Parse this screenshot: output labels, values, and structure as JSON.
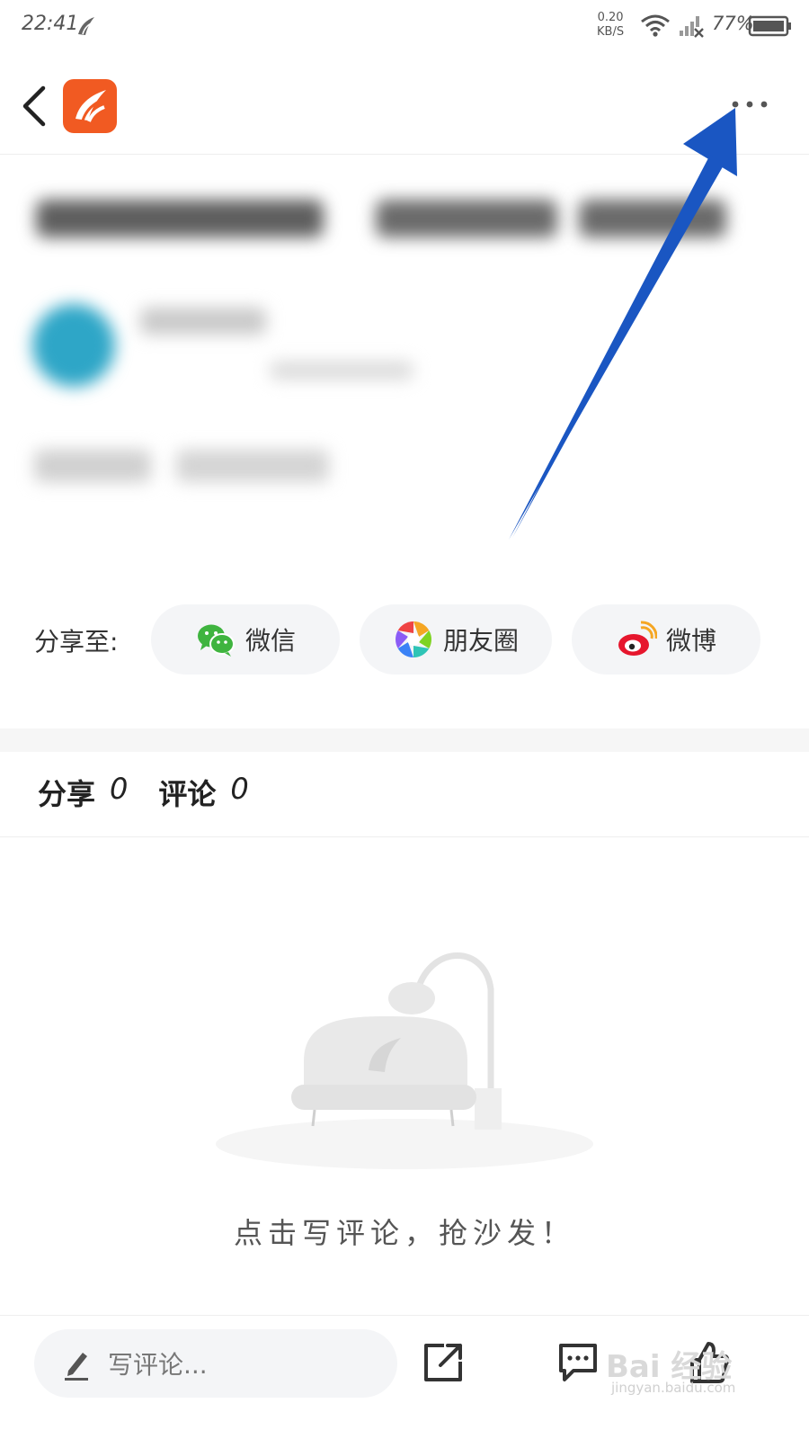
{
  "status_bar": {
    "time": "22:41",
    "speed_value": "0.20",
    "speed_unit": "KB/S",
    "battery": "77%"
  },
  "nav": {
    "back_icon": "chevron-left-icon",
    "logo_icon": "app-logo",
    "more_icon": "more-dots-icon"
  },
  "share": {
    "label": "分享至:",
    "targets": [
      {
        "label": "微信",
        "icon": "wechat-icon",
        "color": "#3fb43f"
      },
      {
        "label": "朋友圈",
        "icon": "moments-icon",
        "color": "#f5a623"
      },
      {
        "label": "微博",
        "icon": "weibo-icon",
        "color": "#e6162d"
      }
    ]
  },
  "counts": {
    "share_label": "分享",
    "share_count": "0",
    "comment_label": "评论",
    "comment_count": "0"
  },
  "empty_state": {
    "text": "点击写评论，抢沙发！",
    "illustration": "empty-sofa-illustration"
  },
  "bottom_bar": {
    "comment_placeholder": "写评论...",
    "share_icon": "share-out-icon",
    "comments_icon": "comments-icon",
    "like_icon": "thumbs-up-icon"
  },
  "watermark": {
    "text": "Bai 经验",
    "sub": "jingyan.baidu.com"
  },
  "colors": {
    "brand": "#f15a22",
    "annotation_arrow": "#1a56c2",
    "pill_bg": "#f4f5f7"
  }
}
